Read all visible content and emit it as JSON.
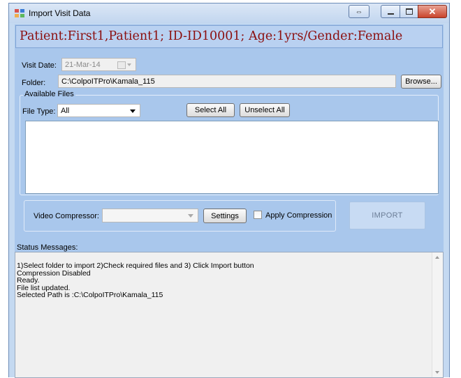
{
  "window": {
    "title": "Import Visit Data"
  },
  "patient": {
    "header": "Patient:First1,Patient1; ID-ID10001; Age:1yrs/Gender:Female"
  },
  "visit": {
    "date_label": "Visit Date:",
    "date_value": "21-Mar-14"
  },
  "folder": {
    "label": "Folder:",
    "path": "C:\\ColpoITPro\\Kamala_115",
    "browse_label": "Browse..."
  },
  "files": {
    "group_title": "Available Files",
    "type_label": "File Type:",
    "type_value": "All",
    "select_all_label": "Select All",
    "unselect_all_label": "Unselect All"
  },
  "compression": {
    "label": "Video Compressor:",
    "value": "",
    "settings_label": "Settings",
    "apply_label": "Apply Compression",
    "apply_checked": false
  },
  "import_button": {
    "label": "IMPORT"
  },
  "status": {
    "label": "Status Messages:",
    "lines": [
      "1)Select folder to import 2)Check required files and 3) Click Import button",
      "Compression Disabled",
      "Ready.",
      "File list updated.",
      "Selected Path is :C:\\ColpoITPro\\Kamala_115"
    ]
  },
  "colors": {
    "patient_text": "#8b0f0f",
    "client_background": "#a9c7ec",
    "close_button": "#c9442c"
  }
}
